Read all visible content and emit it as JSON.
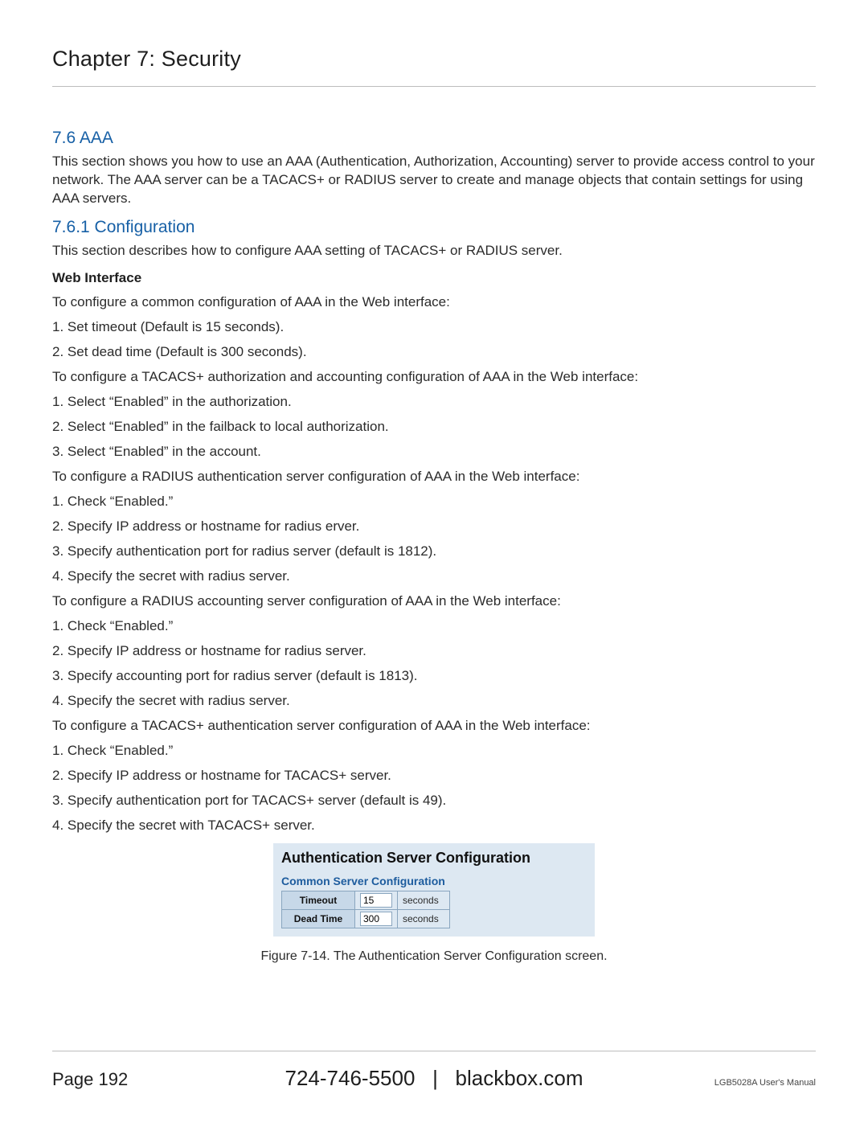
{
  "chapter_title": "Chapter 7: Security",
  "section_1": {
    "heading": "7.6 AAA",
    "intro": "This section shows you how to use an AAA (Authentication, Authorization, Accounting) server to provide access control to your network. The AAA server can be a TACACS+ or RADIUS server to create and manage objects that contain settings for using AAA servers."
  },
  "section_2": {
    "heading": "7.6.1 Configuration",
    "intro": "This section describes how to configure AAA setting of TACACS+ or RADIUS server.",
    "sub": "Web Interface",
    "p1": "To configure a common configuration of AAA in the Web interface:",
    "l1": "1. Set timeout (Default is 15 seconds).",
    "l2": "2. Set dead time (Default is 300 seconds).",
    "p2": "To configure a TACACS+ authorization and accounting configuration of AAA in the Web interface:",
    "l3": "1. Select “Enabled” in the authorization.",
    "l4": "2. Select “Enabled” in the failback to local authorization.",
    "l5": "3. Select “Enabled” in the account.",
    "p3": "To configure a RADIUS authentication server configuration of AAA in the Web interface:",
    "l6": "1. Check “Enabled.”",
    "l7": "2. Specify IP address or hostname for radius erver.",
    "l8": "3. Specify authentication port for radius server (default is 1812).",
    "l9": "4. Specify the secret with radius server.",
    "p4": "To configure a RADIUS accounting server configuration of AAA in the Web interface:",
    "l10": "1. Check “Enabled.”",
    "l11": "2. Specify IP address or hostname for radius server.",
    "l12": "3. Specify accounting port for radius server (default is 1813).",
    "l13": "4. Specify the secret with radius server.",
    "p5": "To configure a TACACS+ authentication server configuration of AAA in the Web interface:",
    "l14": "1. Check “Enabled.”",
    "l15": "2. Specify IP address or hostname for TACACS+ server.",
    "l16": "3. Specify authentication port for TACACS+ server (default is 49).",
    "l17": "4. Specify the secret with TACACS+ server."
  },
  "figure": {
    "title": "Authentication Server Configuration",
    "subtitle": "Common Server Configuration",
    "rows": [
      {
        "label": "Timeout",
        "value": "15",
        "unit": "seconds"
      },
      {
        "label": "Dead Time",
        "value": "300",
        "unit": "seconds"
      }
    ],
    "caption": "Figure 7-14. The Authentication Server Configuration screen."
  },
  "footer": {
    "page": "Page 192",
    "phone": "724-746-5500",
    "sep": "|",
    "site": "blackbox.com",
    "manual": "LGB5028A User's Manual"
  }
}
